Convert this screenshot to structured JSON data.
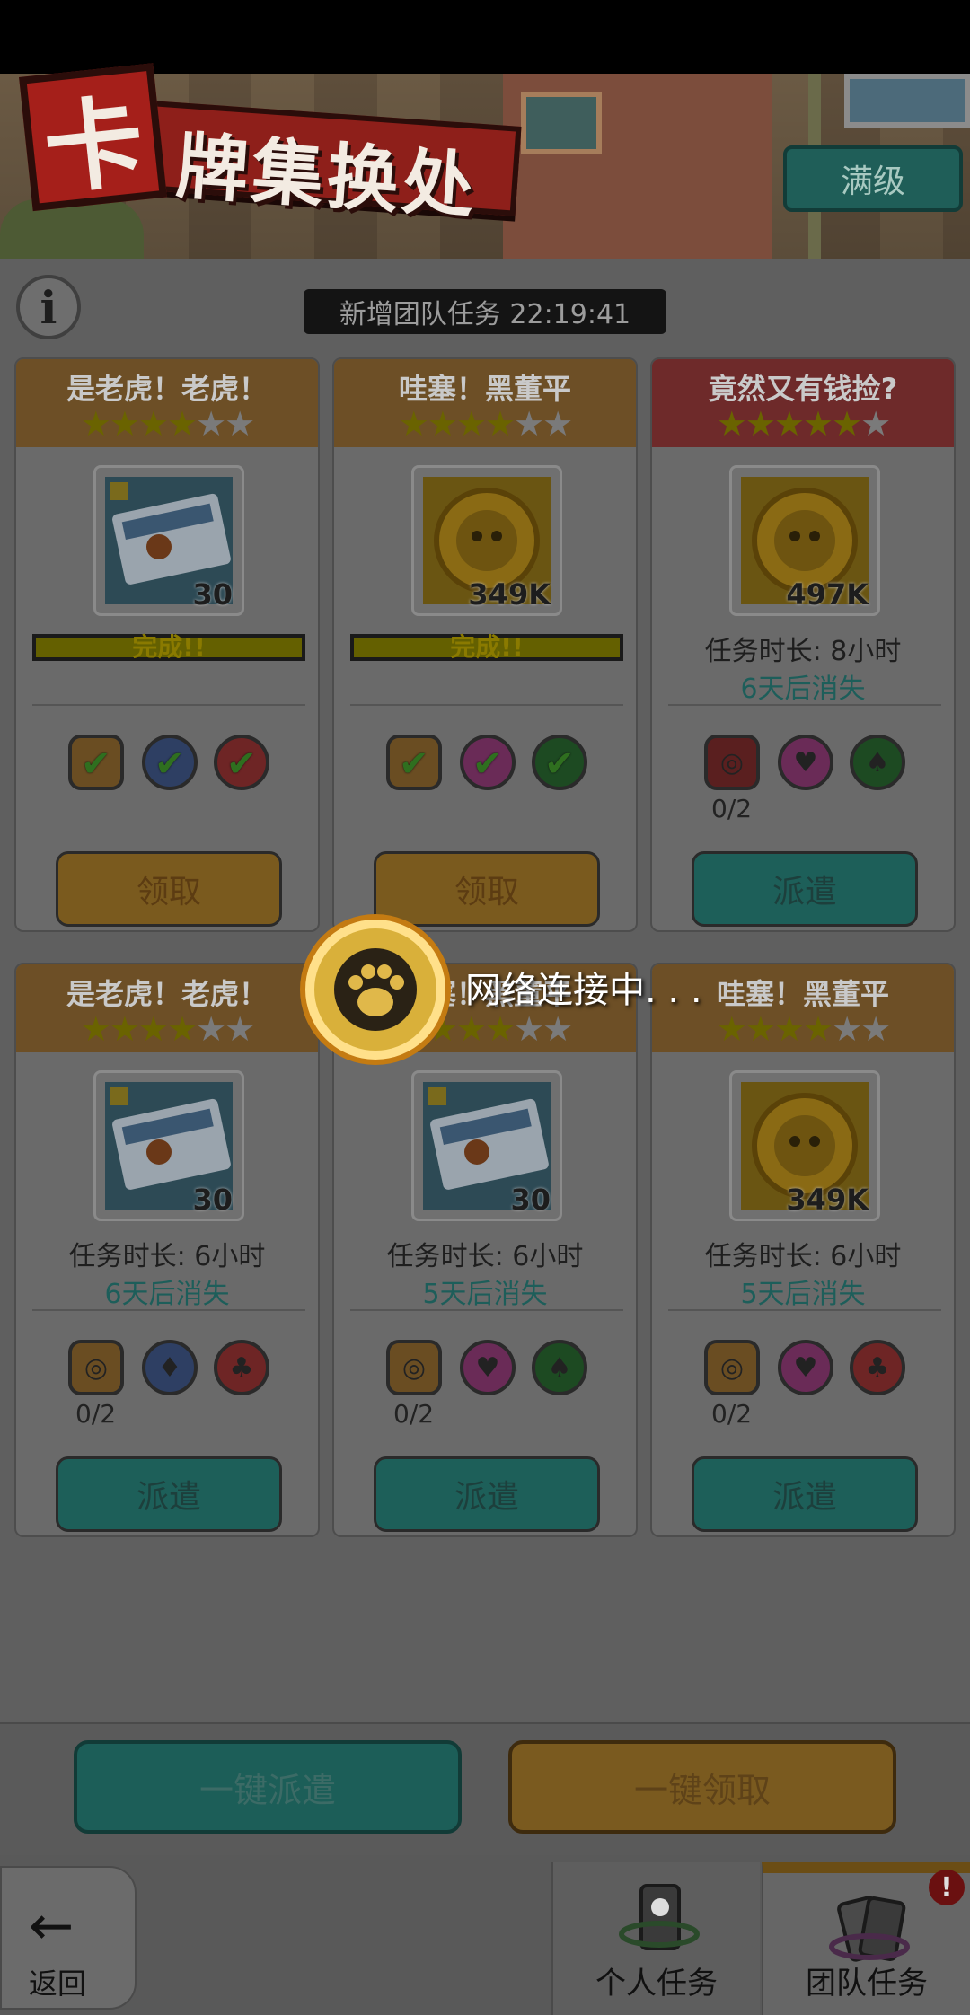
{
  "header": {
    "title_first_char": "卡",
    "title_rest": "牌集换处",
    "max_level_label": "满级"
  },
  "content": {
    "info_icon": "i",
    "timer_text": "新增团队任务 22:19:41"
  },
  "cards": [
    {
      "title": "是老虎！老虎！",
      "stars": 4,
      "max_stars": 6,
      "header_color": "orange",
      "reward_type": "ticket",
      "reward_count": "30",
      "status": "完成!!",
      "requirements": [
        "hex-orange",
        "blue",
        "red"
      ],
      "completed": true,
      "button_label": "领取"
    },
    {
      "title": "哇塞！黑董平",
      "stars": 4,
      "max_stars": 6,
      "header_color": "orange",
      "reward_type": "coin",
      "reward_count": "349K",
      "status": "完成!!",
      "requirements": [
        "hex-orange",
        "pink",
        "green"
      ],
      "completed": true,
      "button_label": "领取"
    },
    {
      "title": "竟然又有钱捡?",
      "stars": 5,
      "max_stars": 6,
      "header_color": "red",
      "reward_type": "coin",
      "reward_count": "497K",
      "duration": "任务时长: 8小时",
      "expire": "6天后消失",
      "requirements": [
        "hex-red",
        "pink",
        "green"
      ],
      "progress": "0/2",
      "button_label": "派遣"
    },
    {
      "title": "是老虎！老虎！",
      "stars": 4,
      "max_stars": 6,
      "header_color": "orange",
      "reward_type": "ticket",
      "reward_count": "30",
      "duration": "任务时长: 6小时",
      "expire": "6天后消失",
      "requirements": [
        "hex-orange",
        "blue",
        "red"
      ],
      "progress": "0/2",
      "button_label": "派遣"
    },
    {
      "title": "哇塞！黑董平",
      "stars": 4,
      "max_stars": 6,
      "header_color": "orange",
      "reward_type": "ticket",
      "reward_count": "30",
      "duration": "任务时长: 6小时",
      "expire": "5天后消失",
      "requirements": [
        "hex-orange",
        "pink",
        "green"
      ],
      "progress": "0/2",
      "button_label": "派遣"
    },
    {
      "title": "哇塞！黑董平",
      "stars": 4,
      "max_stars": 6,
      "header_color": "orange",
      "reward_type": "coin",
      "reward_count": "349K",
      "duration": "任务时长: 6小时",
      "expire": "5天后消失",
      "requirements": [
        "hex-orange",
        "pink",
        "red"
      ],
      "progress": "0/2",
      "button_label": "派遣"
    }
  ],
  "bottom": {
    "bulk_dispatch_label": "一键派遣",
    "bulk_claim_label": "一键领取"
  },
  "nav": {
    "back_label": "返回",
    "personal_tab_label": "个人任务",
    "team_tab_label": "团队任务",
    "alert_badge": "!"
  },
  "loading": {
    "text": "网络连接中. . ."
  },
  "colors": {
    "accent_orange": "#f39c12",
    "accent_teal": "#1abc9c",
    "card_title_red": "#e74c3c"
  }
}
